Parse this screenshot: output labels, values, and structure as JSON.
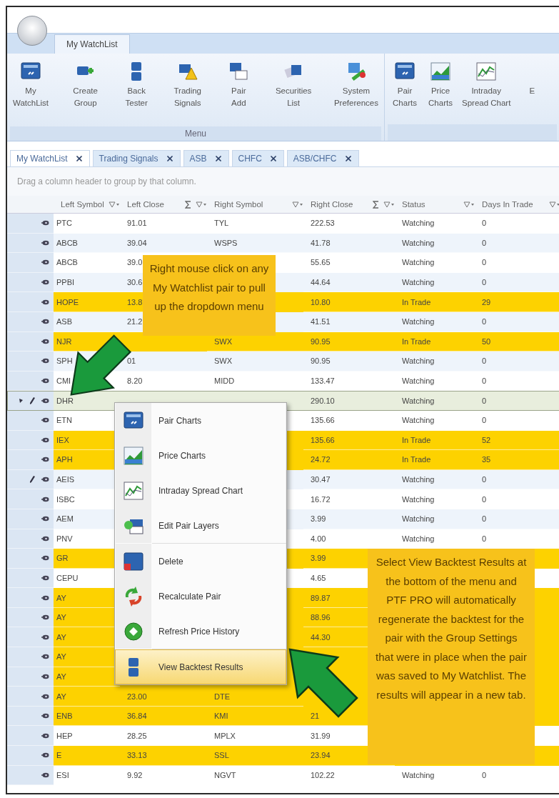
{
  "ribbon": {
    "tabs": [
      {
        "label": "My WatchList",
        "selected": true
      }
    ],
    "groups": [
      {
        "label": "Menu",
        "buttons": [
          "My\nWatchList",
          "Create\nGroup",
          "Back\nTester",
          "Trading\nSignals",
          "Pair\nAdd",
          "Securities\nList",
          "System\nPreferences"
        ]
      },
      {
        "buttons": [
          "Pair\nCharts",
          "Price\nCharts",
          "Intraday\nSpread Chart",
          "E"
        ]
      }
    ]
  },
  "doc_tabs": [
    {
      "label": "My WatchList",
      "selected": true
    },
    {
      "label": "Trading Signals",
      "selected": false
    },
    {
      "label": "ASB",
      "selected": false
    },
    {
      "label": "CHFC",
      "selected": false
    },
    {
      "label": "ASB/CHFC",
      "selected": false
    }
  ],
  "group_panel": "Drag a column header to group by that column.",
  "table": {
    "columns": [
      {
        "label": "Left Symbol",
        "sum": false
      },
      {
        "label": "Left Close",
        "sum": true
      },
      {
        "label": "Right Symbol",
        "sum": false
      },
      {
        "label": "Right Close",
        "sum": true
      },
      {
        "label": "Status",
        "sum": false
      },
      {
        "label": "Days In Trade",
        "sum": false
      }
    ],
    "rows": [
      {
        "cells": [
          "PTC",
          "91.01",
          "TYL",
          "222.53",
          "Watching",
          "0"
        ],
        "in_trade": false,
        "selected": false
      },
      {
        "cells": [
          "ABCB",
          "39.04",
          "WSPS",
          "41.78",
          "Watching",
          "0"
        ],
        "in_trade": false,
        "selected": false
      },
      {
        "cells": [
          "ABCB",
          "39.0",
          null,
          "55.65",
          "Watching",
          "0"
        ],
        "in_trade": false,
        "selected": false
      },
      {
        "cells": [
          "PPBI",
          "30.6",
          null,
          "44.64",
          "Watching",
          "0"
        ],
        "in_trade": false,
        "selected": false
      },
      {
        "cells": [
          "HOPE",
          "13.8",
          null,
          "10.80",
          "In Trade",
          "29"
        ],
        "in_trade": true,
        "selected": false
      },
      {
        "cells": [
          "ASB",
          "21.2",
          null,
          "41.51",
          "Watching",
          "0"
        ],
        "in_trade": false,
        "selected": false
      },
      {
        "cells": [
          "NJR",
          null,
          "SWX",
          "90.95",
          "In Trade",
          "50"
        ],
        "in_trade": true,
        "selected": false
      },
      {
        "cells": [
          "SPH",
          "01",
          "SWX",
          "90.95",
          "Watching",
          "0"
        ],
        "in_trade": false,
        "selected": false,
        "edited": false
      },
      {
        "cells": [
          "CMI",
          "8.20",
          "MIDD",
          "133.47",
          "Watching",
          "0"
        ],
        "in_trade": false,
        "selected": false
      },
      {
        "cells": [
          "DHR",
          null,
          null,
          "290.10",
          "Watching",
          "0"
        ],
        "in_trade": false,
        "selected": true,
        "edited": true
      },
      {
        "cells": [
          "ETN",
          null,
          null,
          "135.66",
          "Watching",
          "0"
        ],
        "in_trade": false,
        "selected": false
      },
      {
        "cells": [
          "IEX",
          null,
          null,
          "135.66",
          "In Trade",
          "52"
        ],
        "in_trade": true,
        "selected": false
      },
      {
        "cells": [
          "APH",
          null,
          null,
          "24.72",
          "In Trade",
          "35"
        ],
        "in_trade": true,
        "selected": false
      },
      {
        "cells": [
          "AEIS",
          null,
          null,
          "30.47",
          "Watching",
          "0"
        ],
        "in_trade": false,
        "selected": false,
        "edited": true
      },
      {
        "cells": [
          "ISBC",
          null,
          null,
          "16.72",
          "Watching",
          "0"
        ],
        "in_trade": false,
        "selected": false
      },
      {
        "cells": [
          "AEM",
          null,
          null,
          "3.99",
          "Watching",
          "0"
        ],
        "in_trade": false,
        "selected": false
      },
      {
        "cells": [
          "PNV",
          null,
          null,
          "4.00",
          "Watching",
          "0"
        ],
        "in_trade": false,
        "selected": false
      },
      {
        "cells": [
          "GR",
          null,
          null,
          "3.99",
          null,
          null
        ],
        "in_trade": true,
        "selected": false
      },
      {
        "cells": [
          "CEPU",
          null,
          null,
          "4.65",
          null,
          null
        ],
        "in_trade": false,
        "selected": false
      },
      {
        "cells": [
          "AY",
          null,
          null,
          "89.87",
          null,
          null
        ],
        "in_trade": true,
        "selected": false
      },
      {
        "cells": [
          "AY",
          null,
          null,
          "88.96",
          null,
          null
        ],
        "in_trade": true,
        "selected": false
      },
      {
        "cells": [
          "AY",
          null,
          null,
          "44.30",
          null,
          null
        ],
        "in_trade": true,
        "selected": false
      },
      {
        "cells": [
          "AY",
          null,
          null,
          null,
          null,
          null
        ],
        "in_trade": true,
        "selected": false
      },
      {
        "cells": [
          "AY",
          null,
          null,
          null,
          null,
          null
        ],
        "in_trade": true,
        "selected": false
      },
      {
        "cells": [
          "AY",
          "23.00",
          "DTE",
          null,
          null,
          null
        ],
        "in_trade": true,
        "selected": false
      },
      {
        "cells": [
          "ENB",
          "36.84",
          "KMI",
          "21",
          null,
          null
        ],
        "in_trade": true,
        "selected": false
      },
      {
        "cells": [
          "HEP",
          "28.25",
          "MPLX",
          "31.99",
          null,
          null
        ],
        "in_trade": false,
        "selected": false
      },
      {
        "cells": [
          "E",
          "33.13",
          "SSL",
          "23.94",
          null,
          null
        ],
        "in_trade": true,
        "selected": false
      },
      {
        "cells": [
          "ESI",
          "9.92",
          "NGVT",
          "102.22",
          "Watching",
          "0"
        ],
        "in_trade": false,
        "selected": false
      }
    ]
  },
  "context_menu": {
    "sections": [
      [
        {
          "label": "Pair Charts",
          "selected": false
        },
        {
          "label": "Price Charts",
          "selected": false
        },
        {
          "label": "Intraday Spread Chart",
          "selected": false
        },
        {
          "label": "Edit Pair Layers",
          "selected": false
        }
      ],
      [
        {
          "label": "Delete",
          "selected": false
        },
        {
          "label": "Recalculate Pair",
          "selected": false
        },
        {
          "label": "Refresh Price History",
          "selected": false
        }
      ],
      [
        {
          "label": "View Backtest Results",
          "selected": true
        }
      ]
    ]
  },
  "callouts": [
    "Right mouse click on any My Watchlist pair to pull up the dropdown menu",
    "Select View Backtest Results at the bottom of the menu and PTF PRO will automatically regenerate the backtest for the pair with the Group Settings that were in place when the pair was saved to My Watchlist.  The results will appear in a new tab."
  ]
}
